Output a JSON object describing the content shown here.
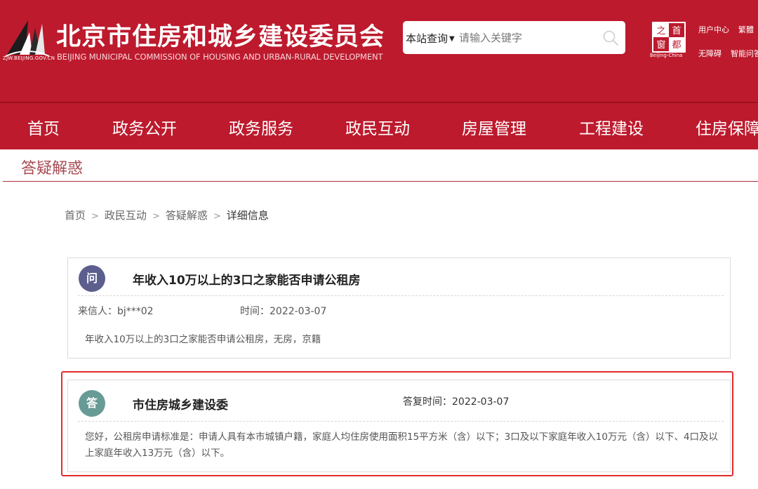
{
  "header": {
    "domain_caption": "ZJW.BEIJING.GOV.CN",
    "title": "北京市住房和城乡建设委员会",
    "subtitle": "BEIJING MUNICIPAL COMMISSION OF HOUSING AND URBAN-RURAL DEVELOPMENT",
    "brand_color": "#bd1a2d",
    "search": {
      "scope_label": "本站查询",
      "placeholder": "请输入关键字",
      "icon": "search-icon"
    },
    "seal": {
      "chars": [
        "之",
        "首",
        "窗",
        "都"
      ],
      "caption": "Beijing-China"
    },
    "top_links": [
      "用户中心",
      "繁體",
      "无障碍",
      "智能问答"
    ]
  },
  "nav": {
    "items": [
      "首页",
      "政务公开",
      "政务服务",
      "政民互动",
      "房屋管理",
      "工程建设",
      "住房保障"
    ]
  },
  "section": {
    "title": "答疑解惑"
  },
  "breadcrumb": {
    "items": [
      "首页",
      "政民互动",
      "答疑解惑"
    ],
    "current": "详细信息",
    "separator": ">"
  },
  "question": {
    "badge": "问",
    "badge_color": "#5c5e8e",
    "title": "年收入10万以上的3口之家能否申请公租房",
    "sender_label": "来信人：",
    "sender": "bj***02",
    "time_label": "时间：",
    "time": "2022-03-07",
    "body": "年收入10万以上的3口之家能否申请公租房，无房，京籍"
  },
  "answer": {
    "badge": "答",
    "badge_color": "#689b96",
    "title": "市住房城乡建设委",
    "time_label": "答复时间：",
    "time": "2022-03-07",
    "body": "您好，公租房申请标准是：申请人具有本市城镇户籍，家庭人均住房使用面积15平方米（含）以下；3口及以下家庭年收入10万元（含）以下、4口及以上家庭年收入13万元（含）以下。",
    "highlight_color": "#e32b2b"
  }
}
